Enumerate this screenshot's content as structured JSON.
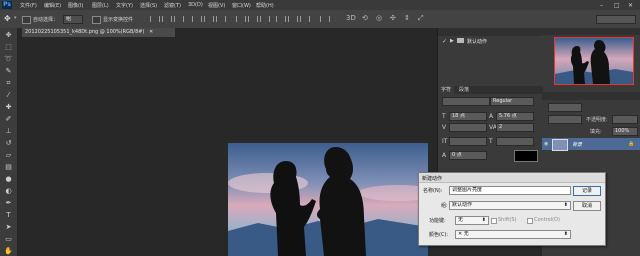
{
  "app": {
    "logo": "Ps"
  },
  "menu": [
    "文件(F)",
    "编辑(E)",
    "图像(I)",
    "图层(L)",
    "文字(Y)",
    "选择(S)",
    "滤镜(T)",
    "3D(D)",
    "视图(V)",
    "窗口(W)",
    "帮助(H)"
  ],
  "window_controls": [
    "–",
    "□",
    "✕"
  ],
  "options_bar": {
    "auto_select_label": "自动选择：",
    "auto_select_value": "组",
    "show_transform_label": "显示变换控件"
  },
  "document": {
    "tab_title": "20120225105351_k48Dt.png @ 100%(RGB/8#)"
  },
  "actions_panel": {
    "set_name": "默认动作"
  },
  "character_panel": {
    "tabs": [
      "字符",
      "段落"
    ],
    "font_style": "Regular",
    "size": "18 点",
    "leading": "5.76 点",
    "tracking": "2",
    "kerning": "0 点"
  },
  "layers_panel": {
    "opacity_label": "不透明度:",
    "fill_label": "填充:",
    "fill_value": "100%",
    "layer_name": "背景"
  },
  "dialog": {
    "title": "新建动作",
    "name_label": "名称(N):",
    "name_value": "调整图片亮度",
    "set_label": "组:",
    "set_value": "默认动作",
    "function_key_label": "功能键:",
    "function_key_value": "无",
    "shift_label": "Shift(S)",
    "control_label": "Control(O)",
    "color_label": "颜色(C):",
    "color_value": "✕ 无",
    "record_button": "记录",
    "cancel_button": "取消"
  }
}
